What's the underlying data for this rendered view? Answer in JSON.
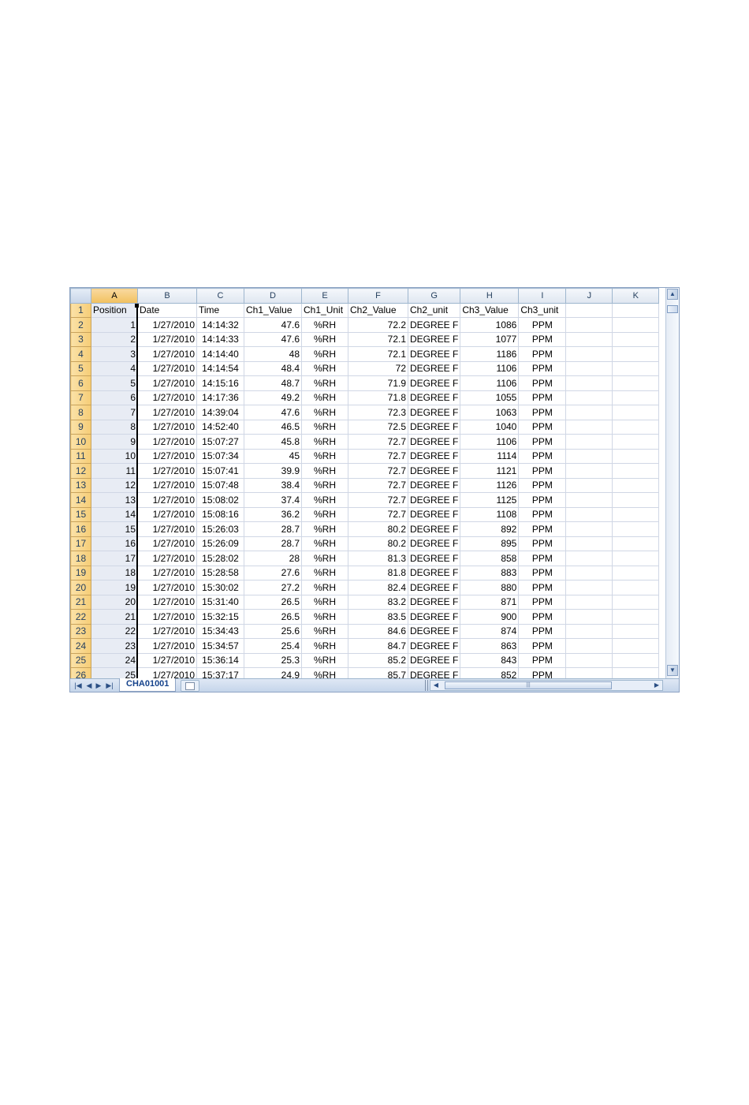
{
  "spreadsheet": {
    "column_headers": [
      "A",
      "B",
      "C",
      "D",
      "E",
      "F",
      "G",
      "H",
      "I",
      "J",
      "K"
    ],
    "header_row": {
      "row_number": "1",
      "cells": [
        "Position",
        "Date",
        "Time",
        "Ch1_Value",
        "Ch1_Unit",
        "Ch2_Value",
        "Ch2_unit",
        "Ch3_Value",
        "Ch3_unit",
        "",
        ""
      ]
    },
    "rows": [
      {
        "row_number": "2",
        "cells": [
          "1",
          "1/27/2010",
          "14:14:32",
          "47.6",
          "%RH",
          "72.2",
          "DEGREE F",
          "1086",
          "PPM"
        ]
      },
      {
        "row_number": "3",
        "cells": [
          "2",
          "1/27/2010",
          "14:14:33",
          "47.6",
          "%RH",
          "72.1",
          "DEGREE F",
          "1077",
          "PPM"
        ]
      },
      {
        "row_number": "4",
        "cells": [
          "3",
          "1/27/2010",
          "14:14:40",
          "48",
          "%RH",
          "72.1",
          "DEGREE F",
          "1186",
          "PPM"
        ]
      },
      {
        "row_number": "5",
        "cells": [
          "4",
          "1/27/2010",
          "14:14:54",
          "48.4",
          "%RH",
          "72",
          "DEGREE F",
          "1106",
          "PPM"
        ]
      },
      {
        "row_number": "6",
        "cells": [
          "5",
          "1/27/2010",
          "14:15:16",
          "48.7",
          "%RH",
          "71.9",
          "DEGREE F",
          "1106",
          "PPM"
        ]
      },
      {
        "row_number": "7",
        "cells": [
          "6",
          "1/27/2010",
          "14:17:36",
          "49.2",
          "%RH",
          "71.8",
          "DEGREE F",
          "1055",
          "PPM"
        ]
      },
      {
        "row_number": "8",
        "cells": [
          "7",
          "1/27/2010",
          "14:39:04",
          "47.6",
          "%RH",
          "72.3",
          "DEGREE F",
          "1063",
          "PPM"
        ]
      },
      {
        "row_number": "9",
        "cells": [
          "8",
          "1/27/2010",
          "14:52:40",
          "46.5",
          "%RH",
          "72.5",
          "DEGREE F",
          "1040",
          "PPM"
        ]
      },
      {
        "row_number": "10",
        "cells": [
          "9",
          "1/27/2010",
          "15:07:27",
          "45.8",
          "%RH",
          "72.7",
          "DEGREE F",
          "1106",
          "PPM"
        ]
      },
      {
        "row_number": "11",
        "cells": [
          "10",
          "1/27/2010",
          "15:07:34",
          "45",
          "%RH",
          "72.7",
          "DEGREE F",
          "1114",
          "PPM"
        ]
      },
      {
        "row_number": "12",
        "cells": [
          "11",
          "1/27/2010",
          "15:07:41",
          "39.9",
          "%RH",
          "72.7",
          "DEGREE F",
          "1121",
          "PPM"
        ]
      },
      {
        "row_number": "13",
        "cells": [
          "12",
          "1/27/2010",
          "15:07:48",
          "38.4",
          "%RH",
          "72.7",
          "DEGREE F",
          "1126",
          "PPM"
        ]
      },
      {
        "row_number": "14",
        "cells": [
          "13",
          "1/27/2010",
          "15:08:02",
          "37.4",
          "%RH",
          "72.7",
          "DEGREE F",
          "1125",
          "PPM"
        ]
      },
      {
        "row_number": "15",
        "cells": [
          "14",
          "1/27/2010",
          "15:08:16",
          "36.2",
          "%RH",
          "72.7",
          "DEGREE F",
          "1108",
          "PPM"
        ]
      },
      {
        "row_number": "16",
        "cells": [
          "15",
          "1/27/2010",
          "15:26:03",
          "28.7",
          "%RH",
          "80.2",
          "DEGREE F",
          "892",
          "PPM"
        ]
      },
      {
        "row_number": "17",
        "cells": [
          "16",
          "1/27/2010",
          "15:26:09",
          "28.7",
          "%RH",
          "80.2",
          "DEGREE F",
          "895",
          "PPM"
        ]
      },
      {
        "row_number": "18",
        "cells": [
          "17",
          "1/27/2010",
          "15:28:02",
          "28",
          "%RH",
          "81.3",
          "DEGREE F",
          "858",
          "PPM"
        ]
      },
      {
        "row_number": "19",
        "cells": [
          "18",
          "1/27/2010",
          "15:28:58",
          "27.6",
          "%RH",
          "81.8",
          "DEGREE F",
          "883",
          "PPM"
        ]
      },
      {
        "row_number": "20",
        "cells": [
          "19",
          "1/27/2010",
          "15:30:02",
          "27.2",
          "%RH",
          "82.4",
          "DEGREE F",
          "880",
          "PPM"
        ]
      },
      {
        "row_number": "21",
        "cells": [
          "20",
          "1/27/2010",
          "15:31:40",
          "26.5",
          "%RH",
          "83.2",
          "DEGREE F",
          "871",
          "PPM"
        ]
      },
      {
        "row_number": "22",
        "cells": [
          "21",
          "1/27/2010",
          "15:32:15",
          "26.5",
          "%RH",
          "83.5",
          "DEGREE F",
          "900",
          "PPM"
        ]
      },
      {
        "row_number": "23",
        "cells": [
          "22",
          "1/27/2010",
          "15:34:43",
          "25.6",
          "%RH",
          "84.6",
          "DEGREE F",
          "874",
          "PPM"
        ]
      },
      {
        "row_number": "24",
        "cells": [
          "23",
          "1/27/2010",
          "15:34:57",
          "25.4",
          "%RH",
          "84.7",
          "DEGREE F",
          "863",
          "PPM"
        ]
      },
      {
        "row_number": "25",
        "cells": [
          "24",
          "1/27/2010",
          "15:36:14",
          "25.3",
          "%RH",
          "85.2",
          "DEGREE F",
          "843",
          "PPM"
        ]
      },
      {
        "row_number": "26",
        "cells": [
          "25",
          "1/27/2010",
          "15:37:17",
          "24.9",
          "%RH",
          "85.7",
          "DEGREE F",
          "852",
          "PPM"
        ]
      }
    ],
    "selected_column": "A"
  },
  "sheet_tabs": {
    "active_tab": "CHA01001",
    "nav_icons": [
      "first-sheet-icon",
      "prev-sheet-icon",
      "next-sheet-icon",
      "last-sheet-icon"
    ]
  },
  "colors": {
    "row_header": "#f6cd76",
    "selected_column_header": "#f1c15f",
    "gridline": "#d0d7e5",
    "tab_text": "#15428b"
  }
}
